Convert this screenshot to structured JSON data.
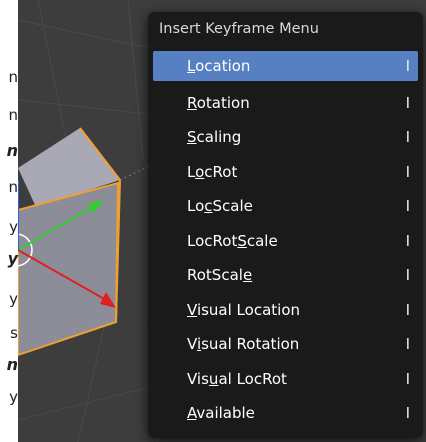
{
  "left_fragments": [
    {
      "text": "n",
      "bold": false
    },
    {
      "text": "n",
      "bold": false
    },
    {
      "text": "n",
      "bold": true
    },
    {
      "text": "n",
      "bold": false
    },
    {
      "text": "y",
      "bold": false
    },
    {
      "text": "y",
      "bold": true
    },
    {
      "text": "y",
      "bold": false
    },
    {
      "text": "s",
      "bold": false
    },
    {
      "text": "n",
      "bold": true
    },
    {
      "text": "y",
      "bold": false
    }
  ],
  "menu": {
    "title": "Insert Keyframe Menu",
    "items": [
      {
        "pre": "",
        "ul": "L",
        "post": "ocation",
        "shortcut": "I",
        "highlighted": true
      },
      {
        "pre": "",
        "ul": "R",
        "post": "otation",
        "shortcut": "I",
        "highlighted": false
      },
      {
        "pre": "",
        "ul": "S",
        "post": "caling",
        "shortcut": "I",
        "highlighted": false
      },
      {
        "pre": "L",
        "ul": "o",
        "post": "cRot",
        "shortcut": "I",
        "highlighted": false
      },
      {
        "pre": "Lo",
        "ul": "c",
        "post": "Scale",
        "shortcut": "I",
        "highlighted": false
      },
      {
        "pre": "LocRot",
        "ul": "S",
        "post": "cale",
        "shortcut": "I",
        "highlighted": false
      },
      {
        "pre": "RotScal",
        "ul": "e",
        "post": "",
        "shortcut": "I",
        "highlighted": false
      },
      {
        "pre": "",
        "ul": "V",
        "post": "isual Location",
        "shortcut": "I",
        "highlighted": false
      },
      {
        "pre": "V",
        "ul": "i",
        "post": "sual Rotation",
        "shortcut": "I",
        "highlighted": false
      },
      {
        "pre": "Vis",
        "ul": "u",
        "post": "al LocRot",
        "shortcut": "I",
        "highlighted": false
      },
      {
        "pre": "",
        "ul": "A",
        "post": "vailable",
        "shortcut": "I",
        "highlighted": false
      }
    ]
  },
  "colors": {
    "highlight": "#5680c2",
    "menu_bg": "#181818",
    "viewport_bg": "#3d3d3d",
    "cube_face": "#8c8d98",
    "selection_outline": "#f0a030",
    "axis_x": "#e02020",
    "axis_y": "#30d030"
  }
}
